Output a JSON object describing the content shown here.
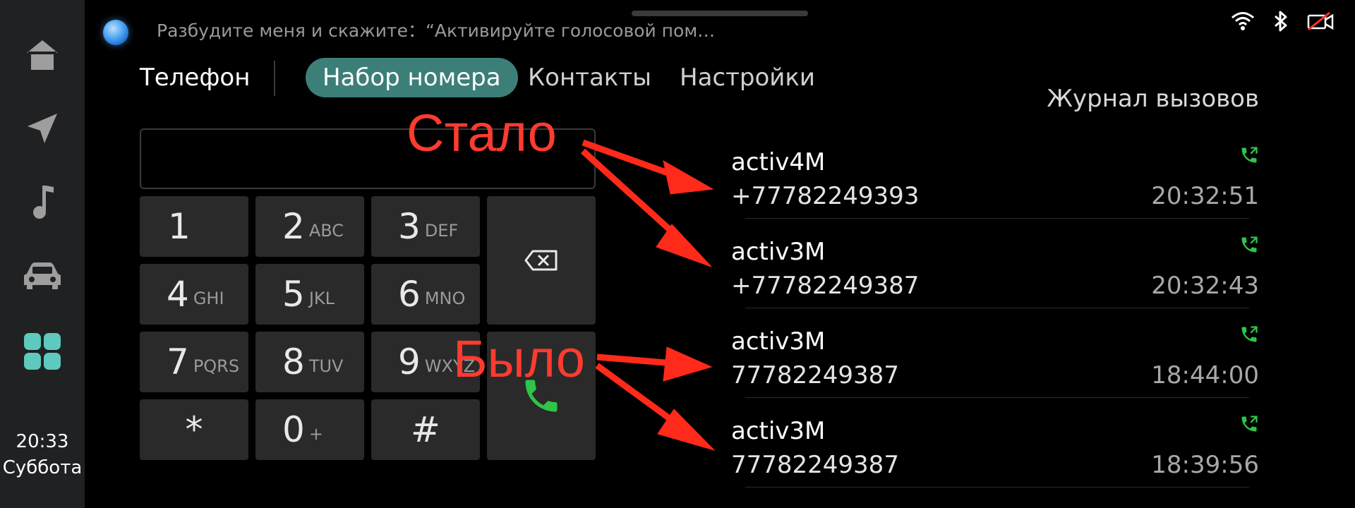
{
  "sidebar": {
    "items": [
      {
        "name": "home-icon"
      },
      {
        "name": "navigation-icon"
      },
      {
        "name": "music-icon"
      },
      {
        "name": "car-icon"
      },
      {
        "name": "apps-icon"
      }
    ],
    "time": "20:33",
    "day": "Суббота"
  },
  "topbar": {
    "hint": "Разбудите меня и скажите：“Активируйте голосовой пом…",
    "icons": [
      "wifi-icon",
      "bluetooth-icon",
      "camera-off-icon"
    ]
  },
  "header": {
    "title": "Телефон",
    "tabs": [
      {
        "label": "Набор номера",
        "active": true
      },
      {
        "label": "Контакты",
        "active": false
      },
      {
        "label": "Настройки",
        "active": false
      }
    ]
  },
  "dialer": {
    "number_value": "",
    "keys": [
      {
        "digit": "1",
        "letters": ""
      },
      {
        "digit": "2",
        "letters": "ABC"
      },
      {
        "digit": "3",
        "letters": "DEF"
      },
      {
        "digit": "4",
        "letters": "GHI"
      },
      {
        "digit": "5",
        "letters": "JKL"
      },
      {
        "digit": "6",
        "letters": "MNO"
      },
      {
        "digit": "7",
        "letters": "PQRS"
      },
      {
        "digit": "8",
        "letters": "TUV"
      },
      {
        "digit": "9",
        "letters": "WXYZ"
      },
      {
        "digit": "*",
        "letters": ""
      },
      {
        "digit": "0",
        "letters": "+"
      },
      {
        "digit": "#",
        "letters": ""
      }
    ]
  },
  "call_log": {
    "title": "Журнал вызовов",
    "entries": [
      {
        "name": "activ4M",
        "number": "+77782249393",
        "time": "20:32:51"
      },
      {
        "name": "activ3M",
        "number": "+77782249387",
        "time": "20:32:43"
      },
      {
        "name": "activ3M",
        "number": "77782249387",
        "time": "18:44:00"
      },
      {
        "name": "activ3M",
        "number": "77782249387",
        "time": "18:39:56"
      }
    ]
  },
  "annotations": {
    "after": "Стало",
    "before": "Было"
  },
  "colors": {
    "accent": "#3c7f78",
    "call_green": "#2fc449",
    "annotation_red": "#ff3b2f",
    "sidebar_accent": "#5ec9bd"
  }
}
